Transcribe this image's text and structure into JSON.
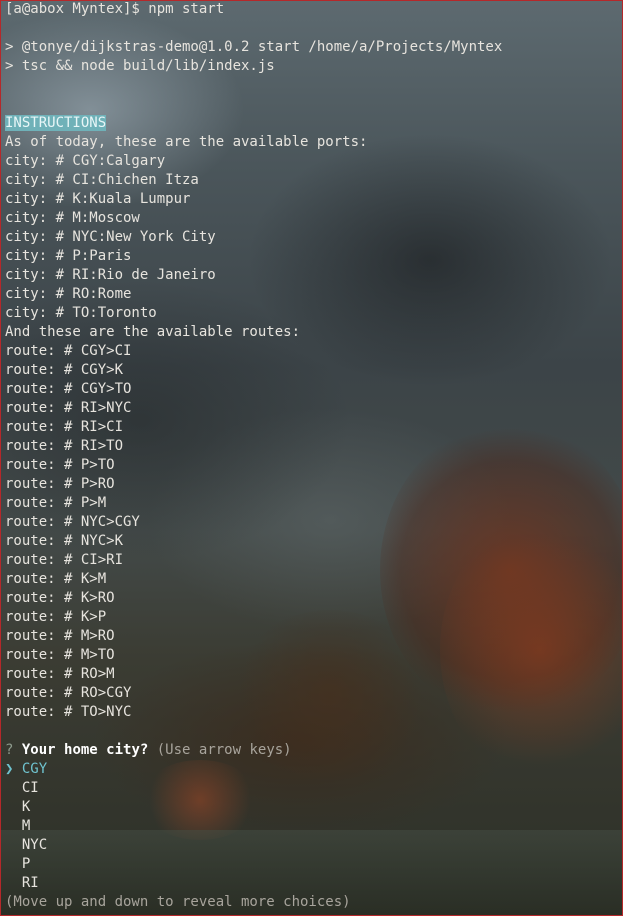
{
  "colors": {
    "border": "#b5282a",
    "highlight": "#6fb1b8",
    "selected": "#6fc3cf"
  },
  "terminal": {
    "prompt_line": "[a@abox Myntex]$ npm start",
    "npm_lines": [
      "> @tonye/dijkstras-demo@1.0.2 start /home/a/Projects/Myntex",
      "> tsc && node build/lib/index.js"
    ],
    "instructions_heading": "INSTRUCTIONS",
    "ports_intro": "As of today, these are the available ports:",
    "cities": [
      "city: # CGY:Calgary",
      "city: # CI:Chichen Itza",
      "city: # K:Kuala Lumpur",
      "city: # M:Moscow",
      "city: # NYC:New York City",
      "city: # P:Paris",
      "city: # RI:Rio de Janeiro",
      "city: # RO:Rome",
      "city: # TO:Toronto"
    ],
    "routes_intro": "And these are the available routes:",
    "routes": [
      "route: # CGY>CI",
      "route: # CGY>K",
      "route: # CGY>TO",
      "route: # RI>NYC",
      "route: # RI>CI",
      "route: # RI>TO",
      "route: # P>TO",
      "route: # P>RO",
      "route: # P>M",
      "route: # NYC>CGY",
      "route: # NYC>K",
      "route: # CI>RI",
      "route: # K>M",
      "route: # K>RO",
      "route: # K>P",
      "route: # M>RO",
      "route: # M>TO",
      "route: # RO>M",
      "route: # RO>CGY",
      "route: # TO>NYC"
    ],
    "question": {
      "marker": "?",
      "text": "Your home city?",
      "hint": "(Use arrow keys)"
    },
    "pointer": "❯",
    "choices": [
      "CGY",
      "CI",
      "K",
      "M",
      "NYC",
      "P",
      "RI"
    ],
    "selected_index": 0,
    "footer": "(Move up and down to reveal more choices)"
  }
}
